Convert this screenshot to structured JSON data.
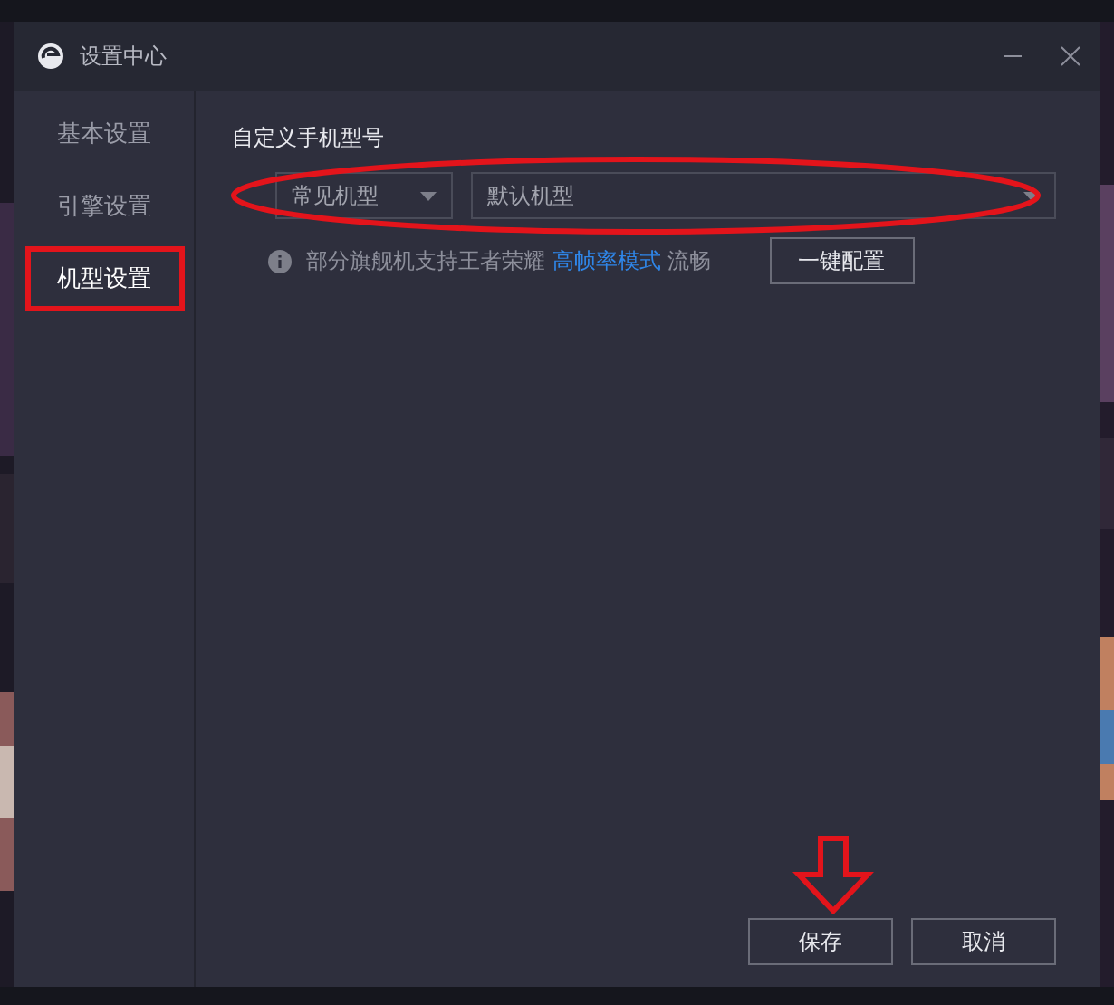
{
  "window": {
    "title": "设置中心"
  },
  "sidebar": {
    "items": [
      {
        "label": "基本设置",
        "selected": false,
        "highlighted": false
      },
      {
        "label": "引擎设置",
        "selected": false,
        "highlighted": false
      },
      {
        "label": "机型设置",
        "selected": true,
        "highlighted": true
      }
    ]
  },
  "content": {
    "heading": "自定义手机型号",
    "circled": true,
    "selects": [
      {
        "value": "常见机型"
      },
      {
        "value": "默认机型"
      }
    ],
    "info": {
      "text": "部分旗舰机支持王者荣耀",
      "link": "高帧率模式",
      "suffix": "流畅"
    },
    "config_button": "一键配置"
  },
  "buttons": [
    {
      "label": "保存",
      "arrow": true
    },
    {
      "label": "取消",
      "arrow": false
    }
  ]
}
